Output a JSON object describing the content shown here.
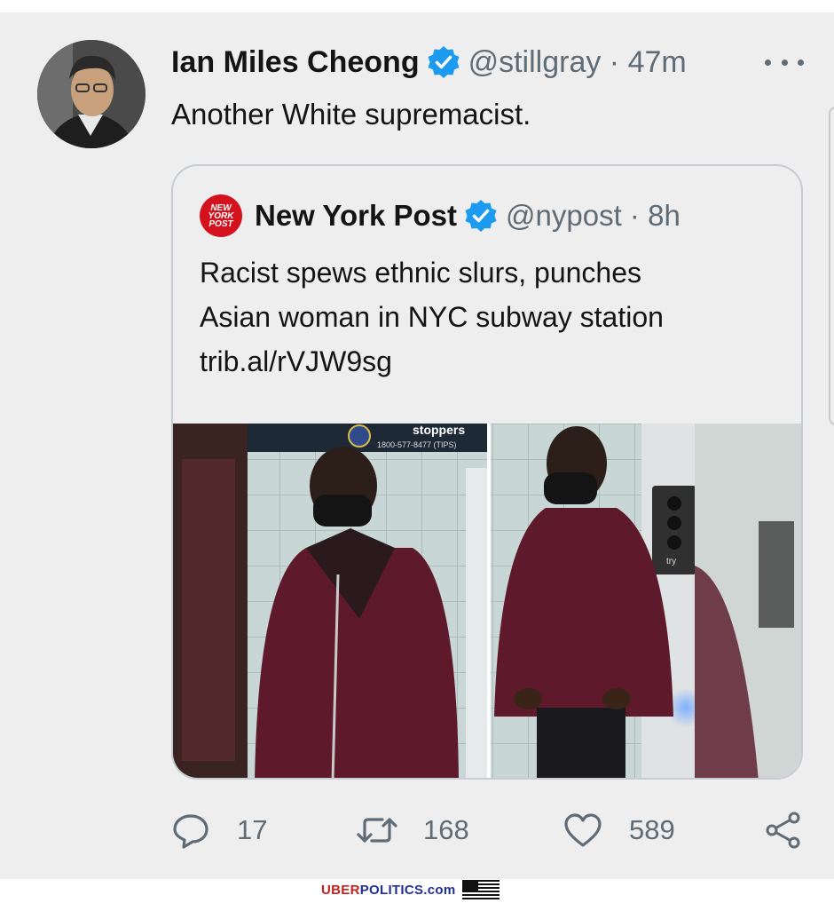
{
  "tweet": {
    "author_name": "Ian Miles Cheong",
    "handle_time": "@stillgray · 47m",
    "text": "Another White supremacist."
  },
  "quoted": {
    "logo_lines": [
      "NEW",
      "YORK",
      "POST"
    ],
    "author_name": "New York Post",
    "handle_time": "@nypost · 8h",
    "text_lines": [
      "Racist spews ethnic slurs, punches",
      "Asian woman in NYC subway station",
      "trib.al/rVJW9sg"
    ],
    "image_overlay": {
      "title": "stoppers",
      "phone": "1800-577-8477 (TIPS)",
      "sign": "try"
    }
  },
  "actions": {
    "replies": "17",
    "retweets": "168",
    "likes": "589"
  },
  "footer": {
    "part1": "UBER",
    "part2": "POLITICS.com"
  },
  "colors": {
    "verified": "#1d9bf0",
    "secondary_text": "#5f6b75",
    "nypost_red": "#d3121e",
    "jacket": "#5e1a2a"
  }
}
